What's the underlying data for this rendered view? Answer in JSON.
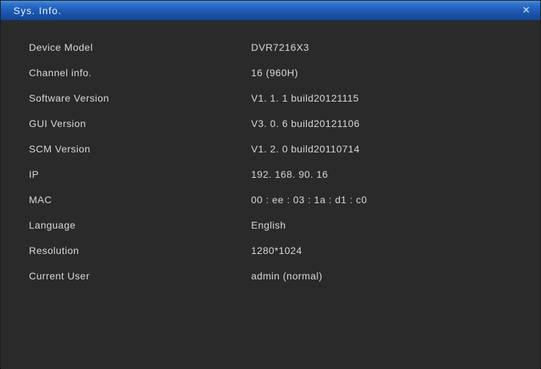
{
  "window": {
    "title": "Sys.  Info."
  },
  "info": {
    "rows": [
      {
        "label": "Device  Model",
        "value": "DVR7216X3"
      },
      {
        "label": "Channel info.",
        "value": "16  (960H)"
      },
      {
        "label": "Software  Version",
        "value": "V1. 1. 1  build20121115"
      },
      {
        "label": "GUI  Version",
        "value": "V3. 0. 6  build20121106"
      },
      {
        "label": "SCM  Version",
        "value": "V1. 2. 0  build20110714"
      },
      {
        "label": "IP",
        "value": "192. 168. 90. 16"
      },
      {
        "label": "MAC",
        "value": "00 : ee : 03 : 1a : d1 : c0"
      },
      {
        "label": "Language",
        "value": "English"
      },
      {
        "label": "Resolution",
        "value": "1280*1024"
      },
      {
        "label": "Current User",
        "value": "admin  (normal)"
      }
    ]
  }
}
